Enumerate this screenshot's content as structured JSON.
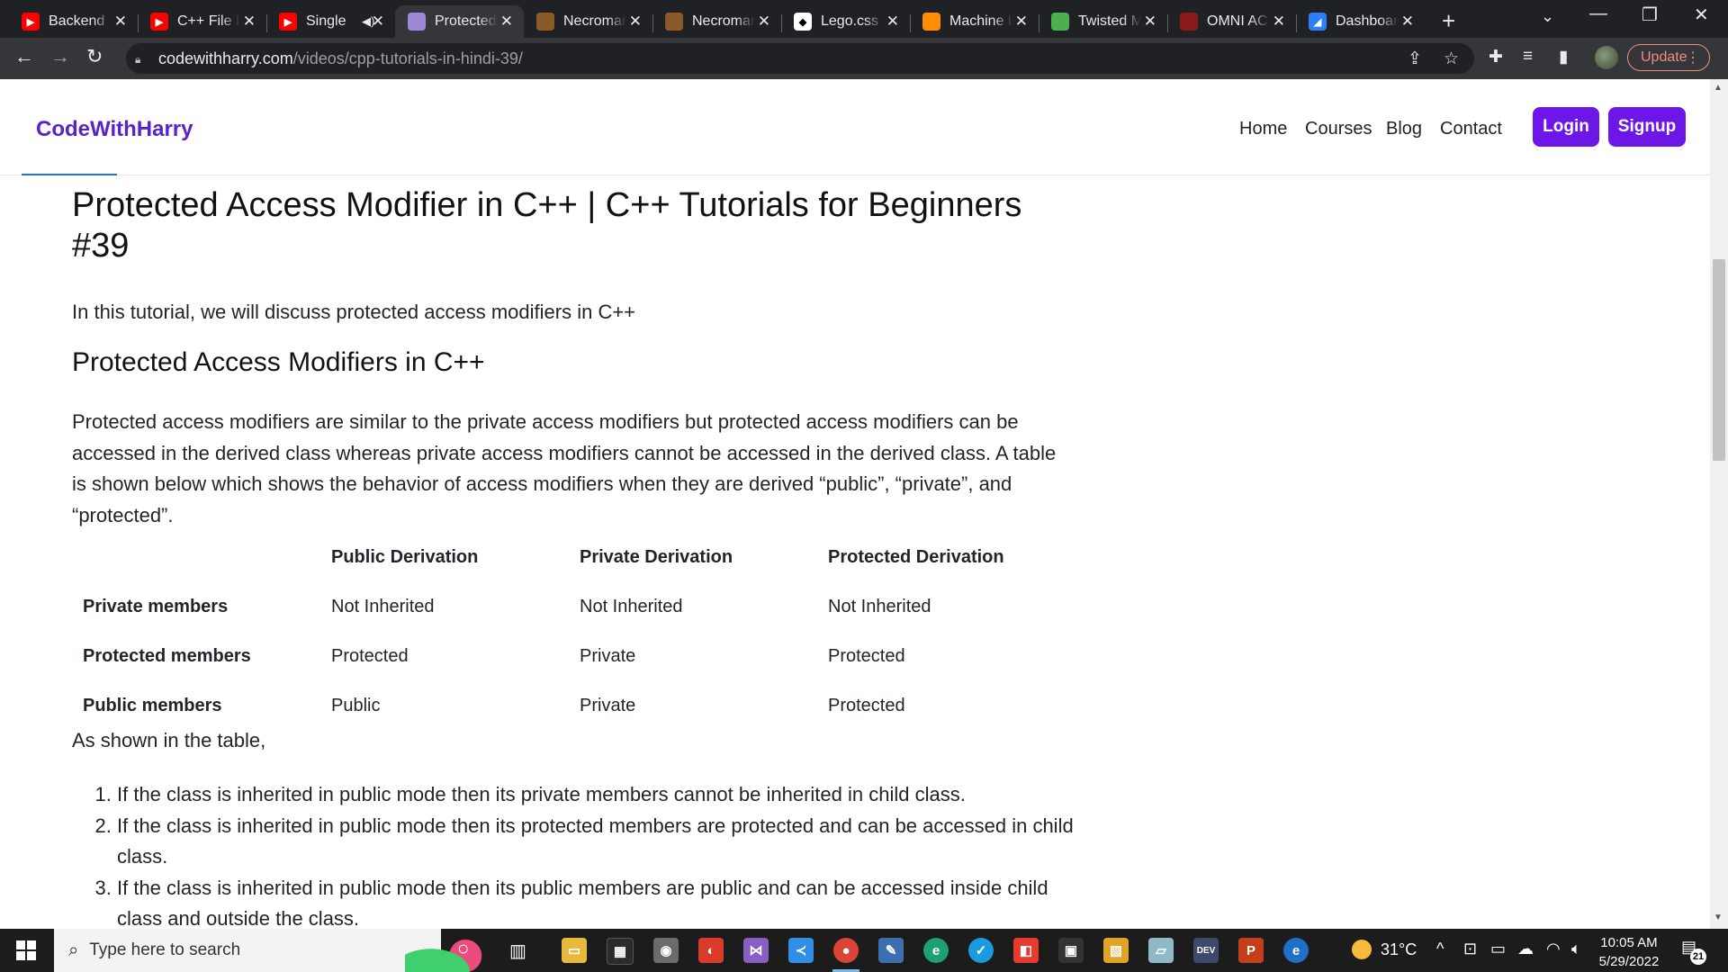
{
  "browser": {
    "tabs": [
      {
        "title": "Backend",
        "icon": "youtube-icon",
        "color": "#ff0000"
      },
      {
        "title": "C++ File I",
        "icon": "youtube-icon",
        "color": "#ff0000"
      },
      {
        "title": "Single",
        "icon": "youtube-icon",
        "color": "#ff0000",
        "muted_icon": "speaker-icon"
      },
      {
        "title": "Protected",
        "icon": "codewithharry-avatar-icon",
        "color": "#9c8ad8",
        "active": true
      },
      {
        "title": "Necromancer",
        "icon": "book-icon",
        "color": "#8b5a2b"
      },
      {
        "title": "Necromancer",
        "icon": "book-icon",
        "color": "#8b5a2b"
      },
      {
        "title": "Lego.css",
        "icon": "lego-icon",
        "color": "#ffffff"
      },
      {
        "title": "Machine Learning",
        "icon": "tensorflow-icon",
        "color": "#ff8f00"
      },
      {
        "title": "Twisted Minds",
        "icon": "twisted-icon",
        "color": "#4caf50"
      },
      {
        "title": "OMNI AC",
        "icon": "omni-icon",
        "color": "#8b1a1a"
      },
      {
        "title": "Dashboard",
        "icon": "dashboard-icon",
        "color": "#2d7ff9"
      }
    ],
    "new_tab": "+",
    "url_domain": "codewithharry.com",
    "url_path": "/videos/cpp-tutorials-in-hindi-39/",
    "update_label": "Update"
  },
  "site": {
    "brand": "CodeWithHarry",
    "nav": [
      "Home",
      "Courses",
      "Blog",
      "Contact"
    ],
    "login_label": "Login",
    "signup_label": "Signup",
    "accent_color": "#6c17e8"
  },
  "article": {
    "title": "Protected Access Modifier in C++ | C++ Tutorials for Beginners #39",
    "intro": "In this tutorial, we will discuss protected access modifiers in C++",
    "subheading": "Protected Access Modifiers in C++",
    "paragraph": "Protected access modifiers are similar to the private access modifiers but protected access modifiers can be accessed in the derived class whereas private access modifiers cannot be accessed in the derived class. A table is shown below which shows the behavior of access modifiers when they are derived “public”, “private”, and “protected”.",
    "table": {
      "headers": [
        "",
        "Public Derivation",
        "Private Derivation",
        "Protected Derivation"
      ],
      "rows": [
        [
          "Private members",
          "Not Inherited",
          "Not Inherited",
          "Not Inherited"
        ],
        [
          "Protected members",
          "Protected",
          "Private",
          "Protected"
        ],
        [
          "Public members",
          "Public",
          "Private",
          "Protected"
        ]
      ]
    },
    "after_table": "As shown in the table,",
    "list": [
      "If the class is inherited in public mode then its private members cannot be inherited in child class.",
      "If the class is inherited in public mode then its protected members are protected and can be accessed in child class.",
      "If the class is inherited in public mode then its public members are public and can be accessed inside child class and outside the class."
    ]
  },
  "taskbar": {
    "search_placeholder": "Type here to search",
    "temperature": "31°C",
    "time": "10:05 AM",
    "date": "5/29/2022",
    "notification_count": "21"
  }
}
